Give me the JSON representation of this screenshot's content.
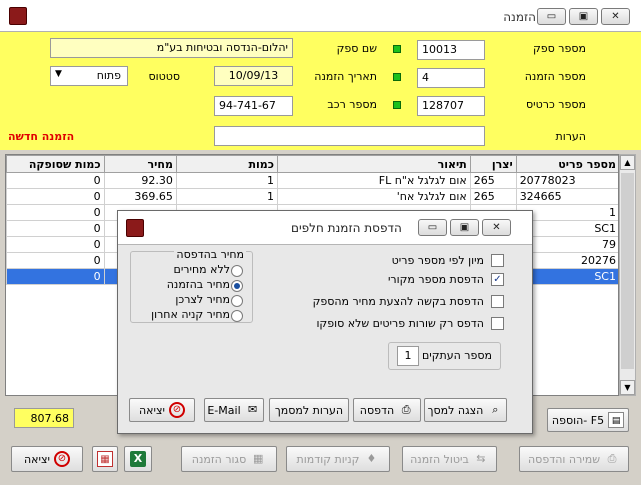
{
  "window": {
    "title": "הזמנה",
    "minimize": "▭",
    "restore": "▣",
    "close": "✕"
  },
  "header": {
    "supplier_no_label": "מספר ספק",
    "supplier_no": "10013",
    "supplier_name_label": "שם ספק",
    "supplier_name": "יהלום-הנדסה ובטיחות בע\"מ",
    "order_no_label": "מספר הזמנה",
    "order_no": "4",
    "order_date_label": "תאריך הזמנה",
    "order_date": "10/09/13",
    "status_label": "סטטוס",
    "status_value": "פתוח",
    "card_no_label": "מספר כרטיס",
    "card_no": "128707",
    "vehicle_no_label": "מספר רכב",
    "vehicle_no": "94-741-67",
    "notes_label": "הערות",
    "notes": "",
    "new_order_label": "הזמנה חדשה"
  },
  "grid": {
    "columns": [
      "מספר פריט",
      "יצרן",
      "תיאור",
      "כמות",
      "מחיר",
      "כמות שסופקה"
    ],
    "rows": [
      [
        "20778023",
        "265",
        "אום לגלגל א\"ח FL",
        "1",
        "92.30",
        "0"
      ],
      [
        "324665",
        "265",
        "אום לגלגל אח'",
        "1",
        "369.65",
        "0"
      ],
      [
        "1",
        "",
        "",
        "",
        "",
        "0"
      ],
      [
        "SC1",
        "",
        "",
        "",
        "",
        "0"
      ],
      [
        "79",
        "",
        "",
        "",
        "",
        "0"
      ],
      [
        "20276",
        "",
        "",
        "",
        "",
        "0"
      ],
      [
        "SC1",
        "",
        "",
        "",
        "",
        "0"
      ]
    ]
  },
  "total_amount": "807.68",
  "buttons": {
    "save_print": "שמירה והדפסה",
    "cancel_order": "ביטול הזמנה",
    "previous_purchases": "קניות קודמות",
    "close_order": "סגור הזמנה",
    "exit": "יציאה",
    "add": "הוספה- F5"
  },
  "dialog": {
    "title": "הדפסת הזמנת חלפים",
    "options": [
      {
        "label": "מיון לפי מספר פריט",
        "checked": false
      },
      {
        "label": "הדפסת מספר מקורי",
        "checked": true
      },
      {
        "label": "הדפסת בקשה להצעת מחיר מהספק",
        "checked": false
      },
      {
        "label": "הדפס רק שורות פריטים שלא סופקו",
        "checked": false
      }
    ],
    "price_group_label": "מחיר בהדפסה",
    "price_options": [
      {
        "label": "ללא מחירים",
        "selected": false
      },
      {
        "label": "מחיר בהזמנה",
        "selected": true
      },
      {
        "label": "מחיר לצרכן",
        "selected": false
      },
      {
        "label": "מחיר קניה אחרון",
        "selected": false
      }
    ],
    "copies_label": "מספר העתקים",
    "copies_value": "1",
    "buttons": {
      "preview": "הצגה למסך",
      "print": "הדפסה",
      "doc_notes": "הערות למסמך",
      "email": "E-Mail",
      "exit": "יציאה"
    }
  },
  "colors": {
    "header_bg": "#ffff60",
    "selected_row": "#3373e0",
    "alert_red": "#e00000",
    "led_green": "#1cc01c"
  }
}
